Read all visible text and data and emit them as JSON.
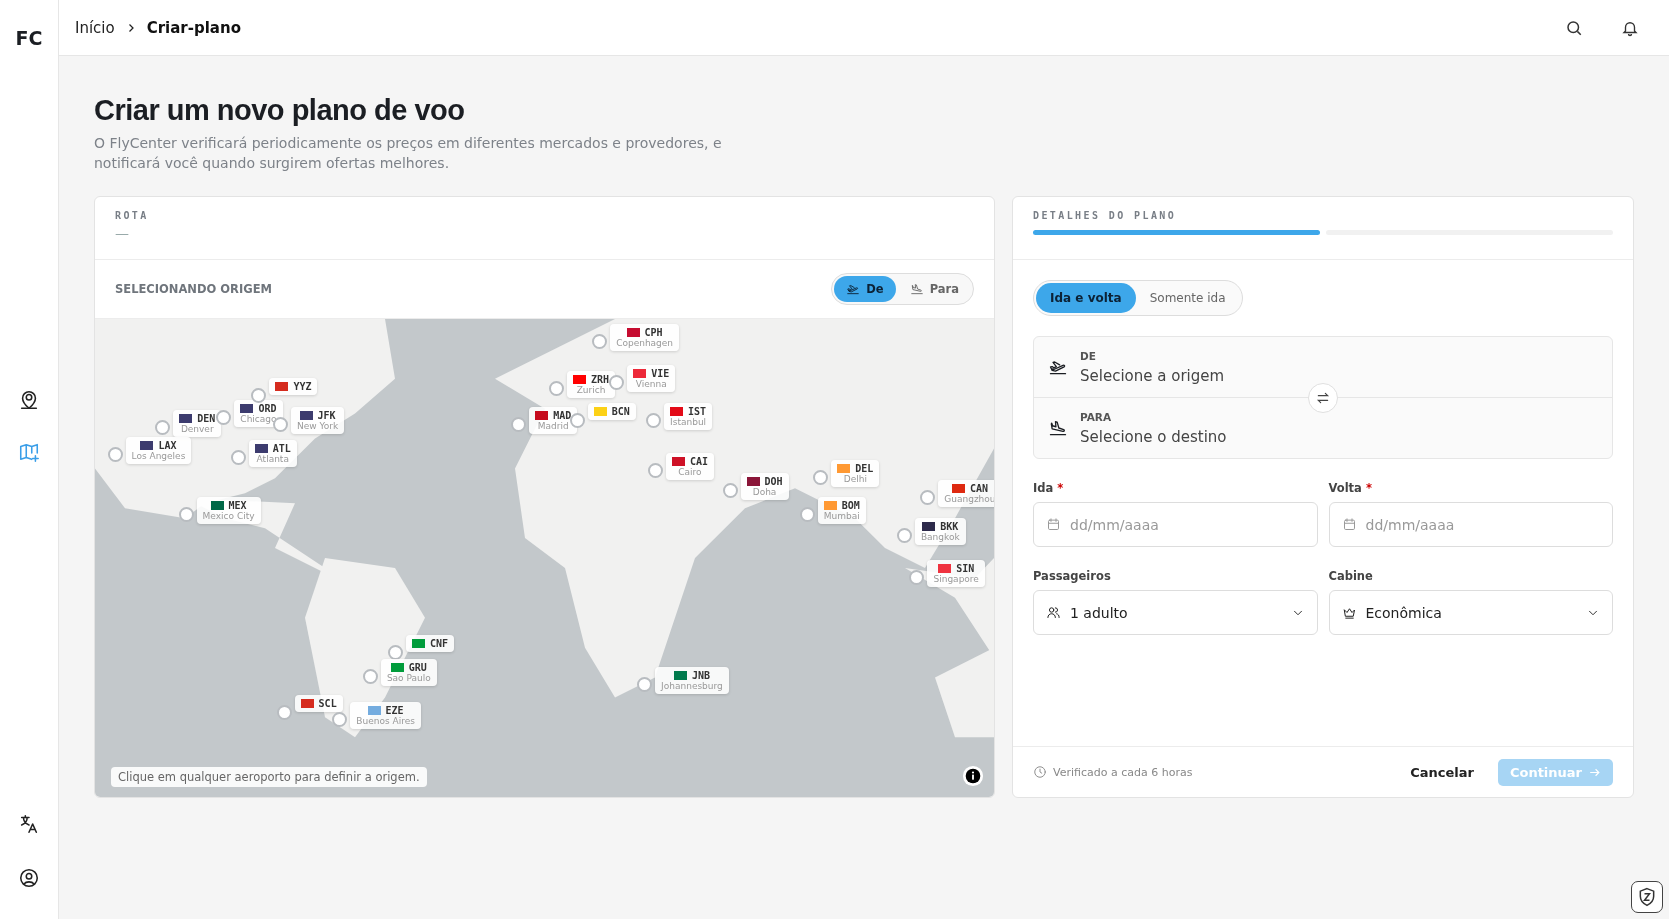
{
  "sidebar": {
    "logo": "FC",
    "items": [
      {
        "kind": "pin",
        "selected": false
      },
      {
        "kind": "map",
        "selected": true
      }
    ],
    "bottom_items": [
      {
        "kind": "translate"
      },
      {
        "kind": "account"
      }
    ]
  },
  "breadcrumb": [
    {
      "label": "Início",
      "current": false
    },
    {
      "label": "Criar-plano",
      "current": true
    }
  ],
  "page": {
    "title": "Criar um novo plano de voo",
    "description": "O FlyCenter verificará periodicamente os preços em diferentes mercados e provedores, e notificará você quando surgirem ofertas melhores."
  },
  "route": {
    "label": "ROTA",
    "value": "—",
    "mode_label": "SELECIONANDO ORIGEM",
    "direction_tabs": [
      {
        "label": "De",
        "kind": "takeoff",
        "selected": true
      },
      {
        "label": "Para",
        "kind": "landing",
        "selected": false
      }
    ],
    "map_hint": "Clique em qualquer aeroporto para definir a origem.",
    "airports": [
      {
        "code": "DEN",
        "city": "Denver",
        "color": "#3c3b6e"
      },
      {
        "code": "ORD",
        "city": "Chicago",
        "color": "#3c3b6e"
      },
      {
        "code": "YYZ",
        "color": "#d52b1e"
      },
      {
        "code": "JFK",
        "city": "New York",
        "color": "#3c3b6e"
      },
      {
        "code": "LAX",
        "city": "Los Angeles",
        "color": "#3c3b6e"
      },
      {
        "code": "ATL",
        "city": "Atlanta",
        "color": "#3c3b6e"
      },
      {
        "code": "MEX",
        "city": "Mexico City",
        "color": "#006847"
      },
      {
        "code": "CPH",
        "city": "Copenhagen",
        "color": "#c60c30"
      },
      {
        "code": "ZRH",
        "city": "Zurich",
        "color": "#ff0000"
      },
      {
        "code": "VIE",
        "city": "Vienna",
        "color": "#ed2939"
      },
      {
        "code": "MAD",
        "city": "Madrid",
        "color": "#c60b1e"
      },
      {
        "code": "BCN",
        "color": "#fcd116"
      },
      {
        "code": "IST",
        "city": "Istanbul",
        "color": "#e30a17"
      },
      {
        "code": "CAI",
        "city": "Cairo",
        "color": "#ce1126"
      },
      {
        "code": "DOH",
        "city": "Doha",
        "color": "#8a1538"
      },
      {
        "code": "DEL",
        "city": "Delhi",
        "color": "#ff9933"
      },
      {
        "code": "BOM",
        "city": "Mumbai",
        "color": "#ff9933"
      },
      {
        "code": "BKK",
        "city": "Bangkok",
        "color": "#2d2a4a"
      },
      {
        "code": "CAN",
        "city": "Guangzhou",
        "color": "#de2910"
      },
      {
        "code": "SIN",
        "city": "Singapore",
        "color": "#ef3340"
      },
      {
        "code": "CNF",
        "color": "#009c3b"
      },
      {
        "code": "GRU",
        "city": "Sao Paulo",
        "color": "#009c3b"
      },
      {
        "code": "SCL",
        "color": "#d52b1e"
      },
      {
        "code": "EZE",
        "city": "Buenos Aires",
        "color": "#74acdf"
      },
      {
        "code": "JNB",
        "city": "Johannesburg",
        "color": "#007a4d"
      }
    ]
  },
  "plan": {
    "label": "DETALHES DO PLANO",
    "steps": [
      {
        "complete": true
      },
      {
        "complete": false
      }
    ],
    "trip_tabs": [
      {
        "label": "Ida e volta",
        "selected": true
      },
      {
        "label": "Somente ida",
        "selected": false
      }
    ],
    "origin": {
      "label": "DE",
      "placeholder": "Selecione a origem"
    },
    "destination": {
      "label": "PARA",
      "placeholder": "Selecione o destino"
    },
    "dates": [
      {
        "label": "Ida",
        "required_mark": "*",
        "placeholder": "dd/mm/aaaa"
      },
      {
        "label": "Volta",
        "required_mark": "*",
        "placeholder": "dd/mm/aaaa"
      }
    ],
    "selects": [
      {
        "label": "Passageiros",
        "kind": "people",
        "value": "1 adulto"
      },
      {
        "label": "Cabine",
        "kind": "crown",
        "value": "Econômica"
      }
    ],
    "footer_note": "Verificado a cada 6 horas",
    "cancel": "Cancelar",
    "continue": {
      "label": "Continuar",
      "disabled": true
    }
  }
}
